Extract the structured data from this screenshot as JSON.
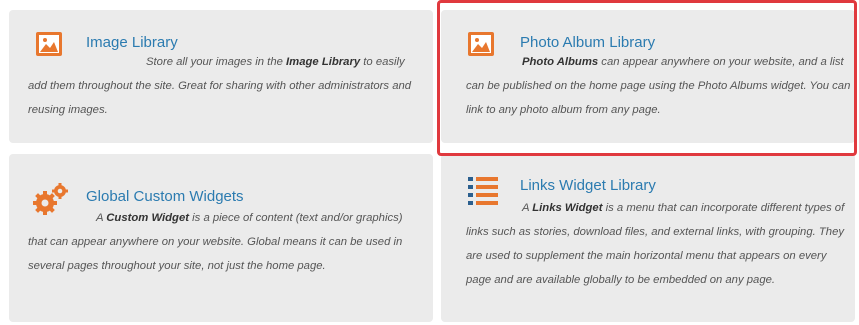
{
  "cards": {
    "image_library": {
      "title": "Image Library",
      "desc_pre": "Store all your images in the ",
      "desc_bold": "Image Library",
      "desc_post": " to easily add them throughout the site. Great for sharing with other administrators and reusing images.",
      "icon": "image-icon"
    },
    "photo_album_library": {
      "title": "Photo Album Library",
      "desc_bold": "Photo Albums",
      "desc_post": " can appear anywhere on your website, and a list can be published on the home page using the Photo Albums widget. You can link to any photo album from any page.",
      "icon": "photo-album-icon"
    },
    "global_custom_widgets": {
      "title": "Global Custom Widgets",
      "desc_pre": "A ",
      "desc_bold": "Custom Widget",
      "desc_post": " is a piece of content (text and/or graphics) that can appear anywhere on your website. Global means it can be used in several pages throughout your site, not just the home page.",
      "icon": "gears-icon"
    },
    "links_widget_library": {
      "title": "Links Widget Library",
      "desc_pre": "A ",
      "desc_bold": "Links Widget",
      "desc_post": " is a menu that can incorporate different types of links such as stories, download files, and external links, with grouping. They are used to supplement the main horizontal menu that appears on every page and are available globally to be embedded on any page.",
      "icon": "list-icon"
    }
  },
  "colors": {
    "accent_orange": "#e8772e",
    "title_blue": "#2b7bb0",
    "card_bg": "#ebebeb",
    "highlight_red": "#e0393e"
  }
}
